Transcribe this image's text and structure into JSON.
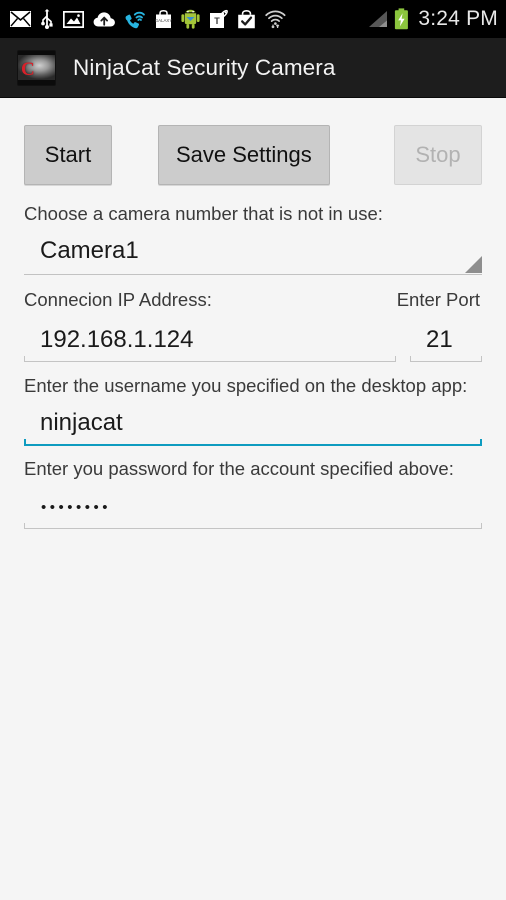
{
  "status_bar": {
    "icons": [
      {
        "name": "email-icon",
        "label": "Email"
      },
      {
        "name": "usb-icon",
        "label": "USB connected"
      },
      {
        "name": "photo-icon",
        "label": "Screenshot captured"
      },
      {
        "name": "cloud-upload-icon",
        "label": "Cloud upload"
      },
      {
        "name": "wifi-call-icon",
        "label": "Wi-Fi calling"
      },
      {
        "name": "galaxy-apps-icon",
        "label": "GALAXY Apps"
      },
      {
        "name": "android-robot-icon",
        "label": "Android system"
      },
      {
        "name": "tmobile-tag-icon",
        "label": "T-Mobile"
      },
      {
        "name": "play-store-icon",
        "label": "Play Store"
      },
      {
        "name": "wifi-signal-icon",
        "label": "Wi-Fi"
      },
      {
        "name": "cell-signal-icon",
        "label": "Cellular signal"
      },
      {
        "name": "battery-charging-icon",
        "label": "Battery charging"
      }
    ],
    "clock": "3:24 PM",
    "battery_color": "#8cc63e",
    "accent_blue": "#27b4e0"
  },
  "action_bar": {
    "title": "NinjaCat Security Camera",
    "icon_name": "app-logo-icon",
    "background": "#1d1d1d"
  },
  "buttons": {
    "start": "Start",
    "save_settings": "Save Settings",
    "stop": "Stop",
    "stop_enabled": false
  },
  "camera": {
    "label": "Choose a camera number that is not in use:",
    "selected": "Camera1",
    "options": [
      "Camera1"
    ]
  },
  "connection": {
    "ip_label": "Connecion IP Address:",
    "ip_value": "192.168.1.124",
    "port_label": "Enter Port",
    "port_value": "21"
  },
  "username": {
    "label": "Enter the username you specified on the desktop app:",
    "value": "ninjacat",
    "focused": true,
    "focus_color": "#0e9cc0"
  },
  "password": {
    "label": "Enter you password for the account specified above:",
    "value": "••••••••",
    "masked_length": 8
  }
}
